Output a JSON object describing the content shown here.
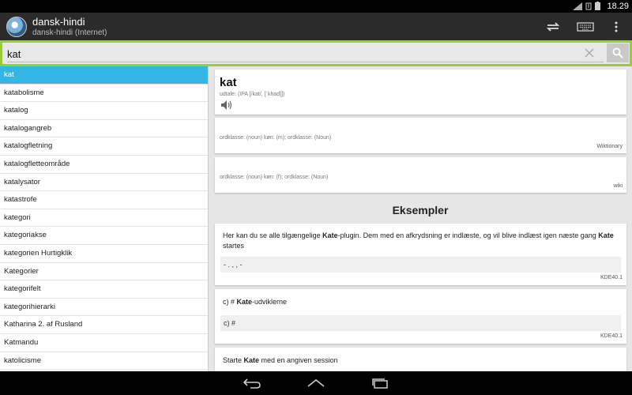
{
  "status": {
    "time": "18.29"
  },
  "action_bar": {
    "title": "dansk-hindi",
    "subtitle": "dansk-hindi (Internet)"
  },
  "search": {
    "value": "kat"
  },
  "word_list": [
    "kat",
    "katabolisme",
    "katalog",
    "katalogangreb",
    "katalogfletning",
    "katalogfletteområde",
    "katalysator",
    "katastrofe",
    "kategori",
    "kategoriakse",
    "kategorien Hurtigklik",
    "Kategorier",
    "kategorifelt",
    "kategorihierarki",
    "Katharina 2. af Rusland",
    "Katmandu",
    "katolicisme"
  ],
  "entry": {
    "word": "kat",
    "pronunciation": "udtale: (IPA [/kat/, [ˈkhad]])",
    "senses": [
      {
        "word_class": "ordklasse: (noun) køn: (m); ordklasse: (Noun)",
        "source": "Wiktionary"
      },
      {
        "word_class": "ordklasse: (noun) køn: (f); ordklasse: (Noun)",
        "source": "wiki"
      }
    ]
  },
  "examples": {
    "heading": "Eksempler",
    "items": [
      {
        "pre": "Her kan du se alle tilgængelige ",
        "bold": "Kate",
        "mid": "-plugin. Dem med en afkrydsning er indlæste, og vil blive indlæst igen næste gang ",
        "bold2": "Kate",
        "post": " startes",
        "translation": "-                        .         ,        ,            -",
        "source": "KDE40.1"
      },
      {
        "pre": "c) # ",
        "bold": "Kate",
        "post": "-udviklerne",
        "translation": "c) #",
        "source": "KDE40.1"
      },
      {
        "pre": "Starte ",
        "bold": "Kate",
        "post": " med en angiven session"
      }
    ]
  },
  "colors": {
    "accent": "#33b5e5",
    "search_border": "#9acd32"
  }
}
